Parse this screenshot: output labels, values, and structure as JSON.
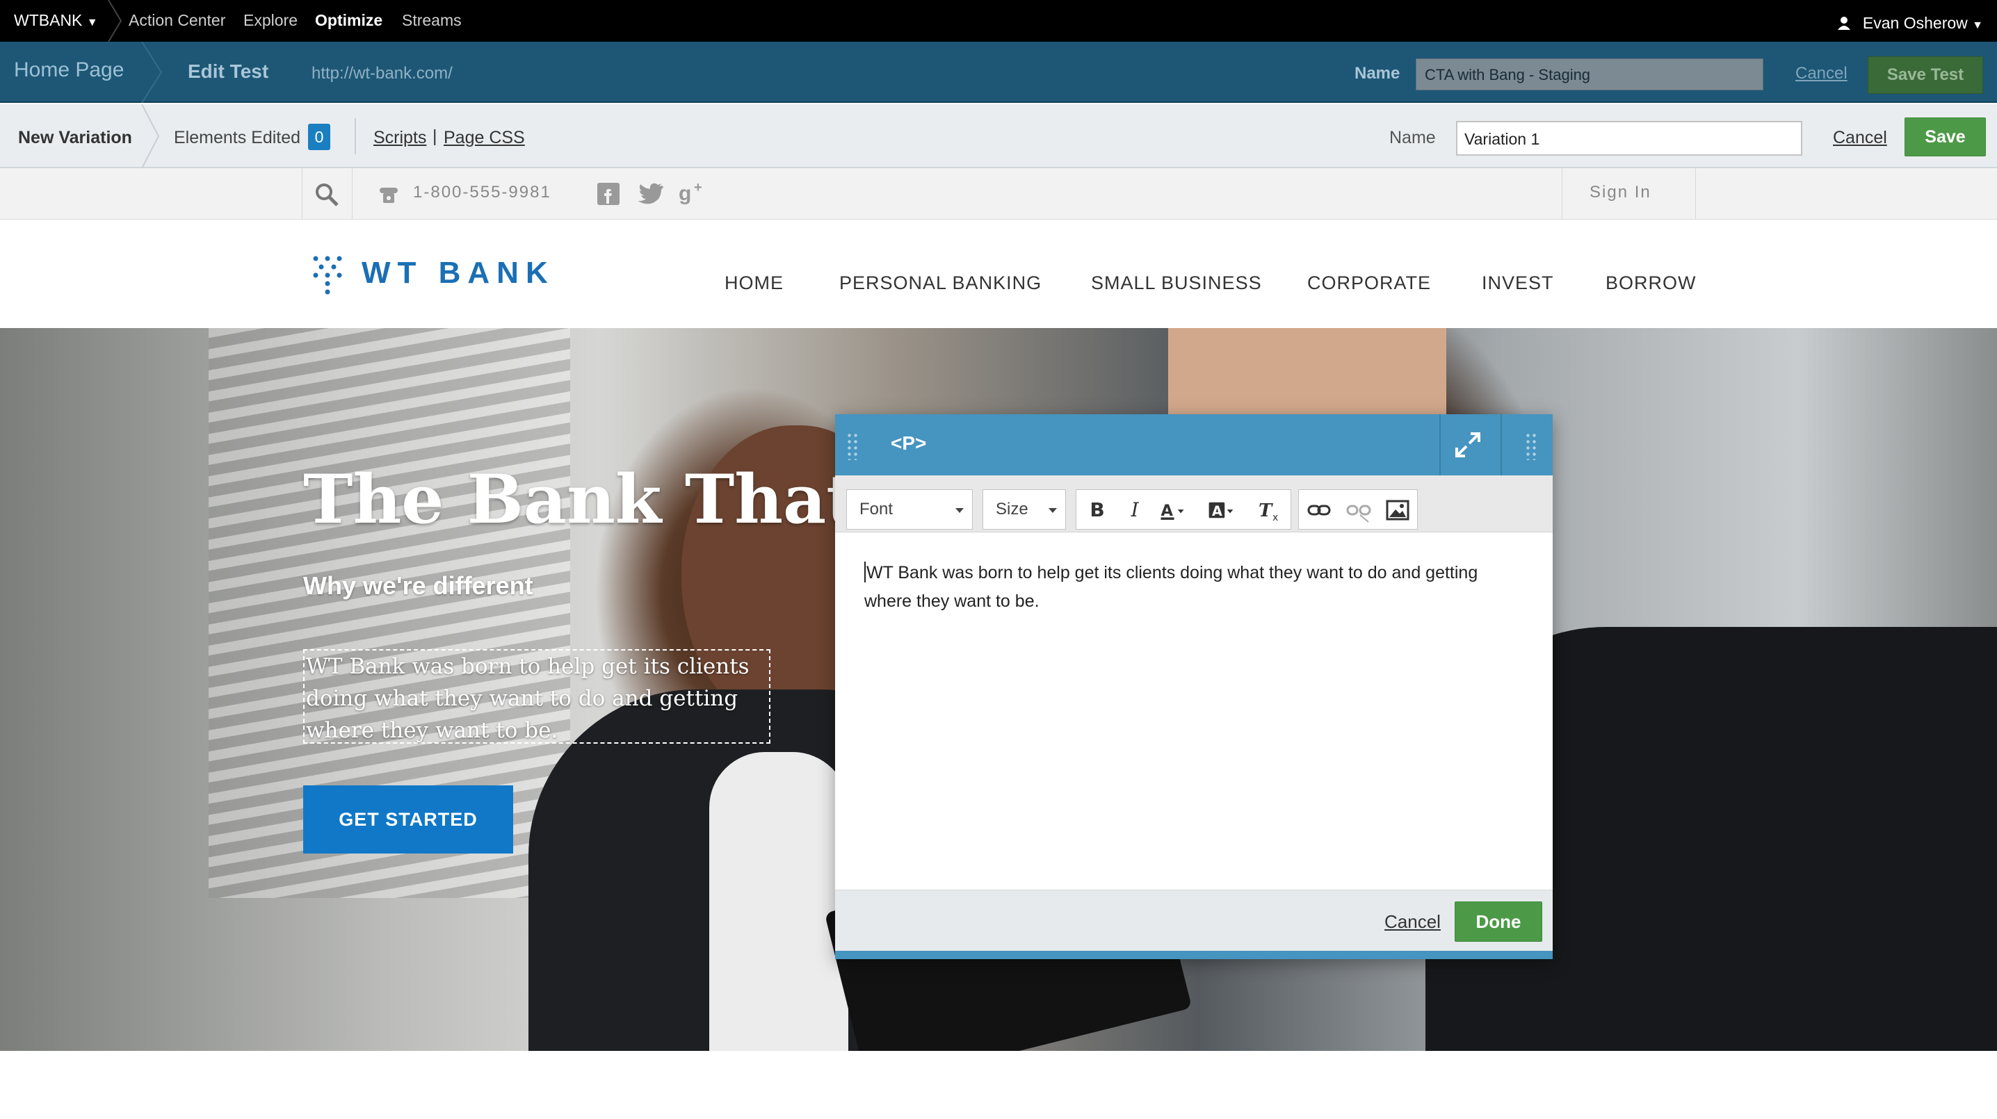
{
  "topnav": {
    "brand": "WTBANK",
    "items": [
      "Action Center",
      "Explore",
      "Optimize",
      "Streams"
    ],
    "user": "Evan Osherow"
  },
  "testbar": {
    "crumb_home": "Home Page",
    "crumb_edit": "Edit Test",
    "url": "http://wt-bank.com/",
    "name_label": "Name",
    "name_value": "CTA with Bang - Staging",
    "cancel": "Cancel",
    "save_test": "Save Test"
  },
  "varbar": {
    "new_variation": "New Variation",
    "elements_edited_label": "Elements Edited",
    "elements_edited_count": "0",
    "scripts": "Scripts",
    "separator": "|",
    "page_css": "Page CSS",
    "name_label": "Name",
    "name_value": "Variation 1",
    "cancel": "Cancel",
    "save": "Save"
  },
  "site": {
    "phone": "1-800-555-9981",
    "sign_in": "Sign In",
    "logo": "WT BANK",
    "menu": [
      "HOME",
      "PERSONAL BANKING",
      "SMALL BUSINESS",
      "CORPORATE",
      "INVEST",
      "BORROW"
    ],
    "hero_headline": "The Bank That Ca",
    "hero_sub": "Why we're different",
    "hero_paragraph": "WT Bank was born to help get its clients doing what they want to do and getting where they want to be.",
    "cta": "GET STARTED"
  },
  "editor": {
    "tag": "<P>",
    "font_label": "Font",
    "size_label": "Size",
    "content": "WT Bank was born to help get its clients doing what they want to do and getting where they want to be.",
    "cancel": "Cancel",
    "done": "Done",
    "icons": [
      "bold-icon",
      "italic-icon",
      "text-color-icon",
      "background-color-icon",
      "remove-format-icon",
      "link-icon",
      "unlink-icon",
      "image-icon",
      "expand-icon",
      "drag-handle-icon"
    ]
  },
  "colors": {
    "testbar_bg": "#1d5775",
    "save_green": "#4c9a47",
    "editor_header": "#4694c0",
    "badge_blue": "#1a7fc1",
    "brand_blue": "#1a6fb5",
    "cta_blue": "#1078c7"
  }
}
